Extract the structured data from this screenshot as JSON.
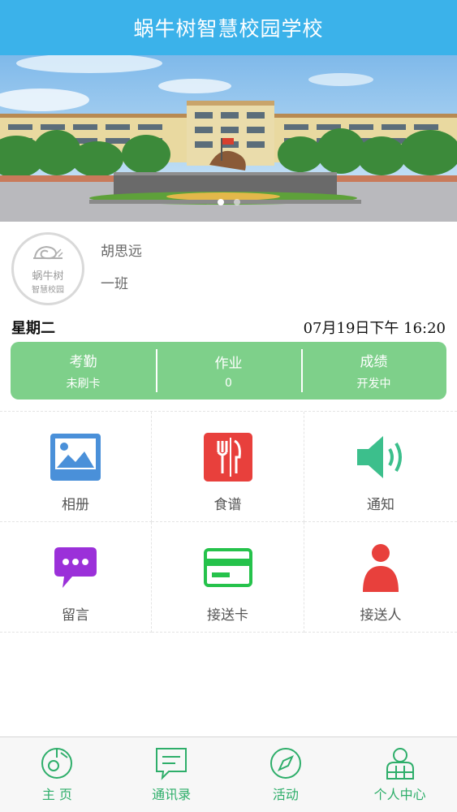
{
  "header": {
    "title": "蜗牛树智慧校园学校"
  },
  "banner": {
    "slide_count": 2,
    "active_slide": 1
  },
  "profile": {
    "name": "胡思远",
    "class": "一班",
    "avatar_line1": "蜗牛树",
    "avatar_line2": "智慧校园"
  },
  "date": {
    "weekday": "星期二",
    "datetime": "07月19日下午 16:20"
  },
  "stats": [
    {
      "title": "考勤",
      "value": "未刷卡"
    },
    {
      "title": "作业",
      "value": "0"
    },
    {
      "title": "成绩",
      "value": "开发中"
    }
  ],
  "grid": [
    {
      "label": "相册",
      "icon": "album-icon"
    },
    {
      "label": "食谱",
      "icon": "recipe-icon"
    },
    {
      "label": "通知",
      "icon": "notice-icon"
    },
    {
      "label": "留言",
      "icon": "message-icon"
    },
    {
      "label": "接送卡",
      "icon": "pickup-card-icon"
    },
    {
      "label": "接送人",
      "icon": "pickup-person-icon"
    }
  ],
  "tabs": [
    {
      "label": "主  页",
      "icon": "home-icon"
    },
    {
      "label": "通讯录",
      "icon": "contacts-icon"
    },
    {
      "label": "活动",
      "icon": "activity-icon"
    },
    {
      "label": "个人中心",
      "icon": "profile-icon"
    }
  ],
  "colors": {
    "header": "#3bb2ea",
    "stats_bg": "#7ed08a",
    "tab_accent": "#2eae6a",
    "album": "#4a90d9",
    "recipe": "#e8403c",
    "notice": "#3cbf8c",
    "message": "#9b30d9",
    "pickup_card": "#25c24b",
    "pickup_person": "#e8403c"
  }
}
